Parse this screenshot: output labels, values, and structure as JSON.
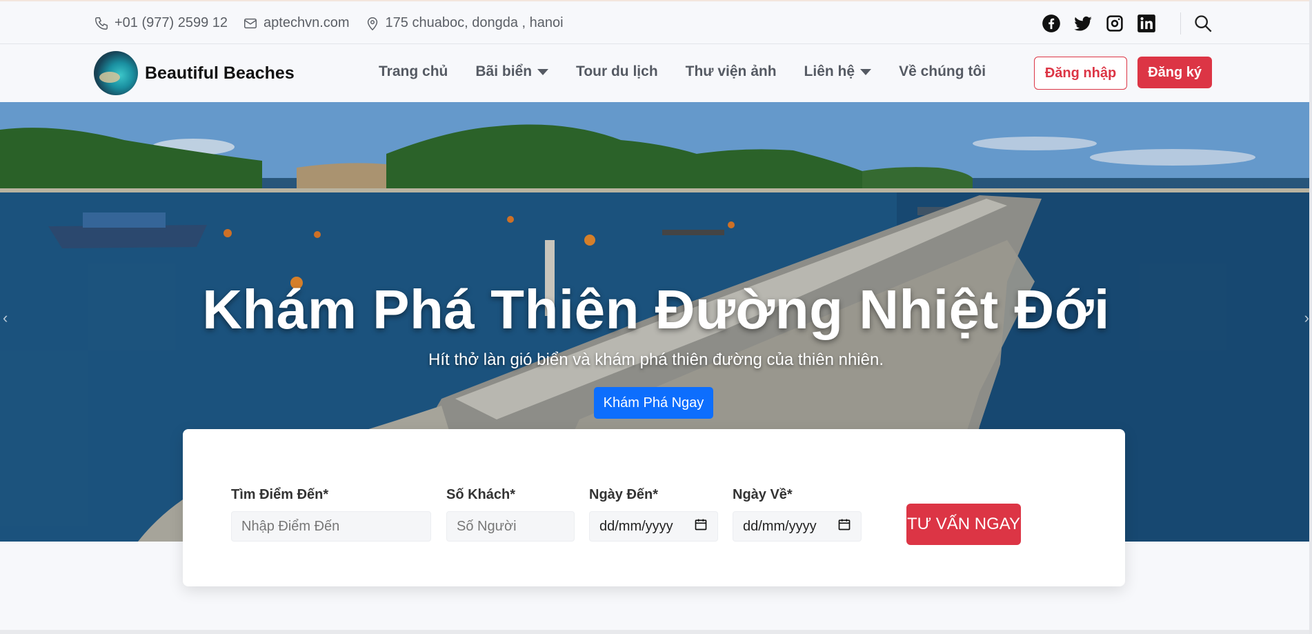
{
  "topbar": {
    "phone": "+01 (977) 2599 12",
    "email": "aptechvn.com",
    "address": "175 chuaboc, dongda , hanoi",
    "social": [
      "facebook-icon",
      "twitter-icon",
      "instagram-icon",
      "linkedin-icon"
    ]
  },
  "navbar": {
    "brand": "Beautiful Beaches",
    "menu": [
      {
        "label": "Trang chủ",
        "dropdown": false
      },
      {
        "label": "Bãi biển",
        "dropdown": true
      },
      {
        "label": "Tour du lịch",
        "dropdown": false
      },
      {
        "label": "Thư viện ảnh",
        "dropdown": false
      },
      {
        "label": "Liên hệ",
        "dropdown": true
      },
      {
        "label": "Về chúng tôi",
        "dropdown": false
      }
    ],
    "login": "Đăng nhập",
    "register": "Đăng ký"
  },
  "hero": {
    "title": "Khám Phá Thiên Đường Nhiệt Đới",
    "subtitle": "Hít thở làn gió biển và khám phá thiên đường của thiên nhiên.",
    "button": "Khám Phá Ngay"
  },
  "booking": {
    "destination": {
      "label": "Tìm Điểm Đến*",
      "placeholder": "Nhập Điểm Đến"
    },
    "guests": {
      "label": "Số Khách*",
      "placeholder": "Số Người"
    },
    "arrival": {
      "label": "Ngày Đến*",
      "value": "dd/mm/yyyy"
    },
    "departure": {
      "label": "Ngày Về*",
      "value": "dd/mm/yyyy"
    },
    "cta": "TƯ VẤN NGAY"
  },
  "colors": {
    "accent": "#dc3545",
    "primary": "#0d6efd"
  }
}
